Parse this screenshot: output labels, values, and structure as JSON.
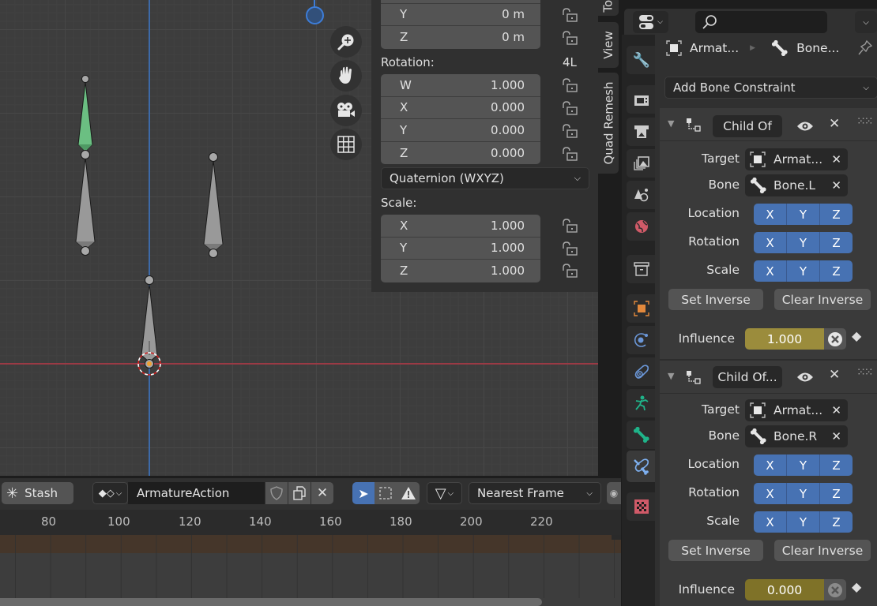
{
  "viewport": {
    "nav_buttons": [
      "zoom",
      "pan",
      "camera",
      "ortho-grid"
    ],
    "bones": [
      {
        "name": "upper-left-bone",
        "selected": true,
        "color": "#6bbf82"
      },
      {
        "name": "lower-left-bone",
        "selected": false,
        "color": "#999999"
      },
      {
        "name": "right-bone",
        "selected": false,
        "color": "#999999"
      },
      {
        "name": "root-bone",
        "selected": false,
        "color": "#999999"
      }
    ]
  },
  "npanel": {
    "location_rows": [
      {
        "axis": "Y",
        "value": "0 m"
      },
      {
        "axis": "Z",
        "value": "0 m"
      }
    ],
    "rotation_label": "Rotation:",
    "rotation_lock_label": "4L",
    "rotation_rows": [
      {
        "axis": "W",
        "value": "1.000"
      },
      {
        "axis": "X",
        "value": "0.000"
      },
      {
        "axis": "Y",
        "value": "0.000"
      },
      {
        "axis": "Z",
        "value": "0.000"
      }
    ],
    "rotation_mode": "Quaternion (WXYZ)",
    "scale_label": "Scale:",
    "scale_rows": [
      {
        "axis": "X",
        "value": "1.000"
      },
      {
        "axis": "Y",
        "value": "1.000"
      },
      {
        "axis": "Z",
        "value": "1.000"
      }
    ],
    "tabs": [
      "Tool",
      "View",
      "Quad Remesh"
    ]
  },
  "timeline": {
    "stash_label": "Stash",
    "action_name": "ArmatureAction",
    "snap_mode": "Nearest Frame",
    "ruler_ticks": [
      "80",
      "100",
      "120",
      "140",
      "160",
      "180",
      "200",
      "220"
    ]
  },
  "properties": {
    "search_placeholder": "",
    "breadcrumb": {
      "object": "Armat...",
      "bone": "Bone..."
    },
    "add_constraint_label": "Add Bone Constraint",
    "accent_color": "#4772b3",
    "influence_color": "#9b8c3c",
    "constraints": [
      {
        "name": "Child Of",
        "target_label": "Target",
        "target": "Armat...",
        "bone_label": "Bone",
        "bone": "Bone.L",
        "location_label": "Location",
        "rotation_label": "Rotation",
        "scale_label": "Scale",
        "axes": [
          "X",
          "Y",
          "Z"
        ],
        "set_inverse": "Set Inverse",
        "clear_inverse": "Clear Inverse",
        "influence_label": "Influence",
        "influence": "1.000"
      },
      {
        "name": "Child Of...",
        "target_label": "Target",
        "target": "Armat...",
        "bone_label": "Bone",
        "bone": "Bone.R",
        "location_label": "Location",
        "rotation_label": "Rotation",
        "scale_label": "Scale",
        "axes": [
          "X",
          "Y",
          "Z"
        ],
        "set_inverse": "Set Inverse",
        "clear_inverse": "Clear Inverse",
        "influence_label": "Influence",
        "influence": "0.000"
      }
    ]
  }
}
